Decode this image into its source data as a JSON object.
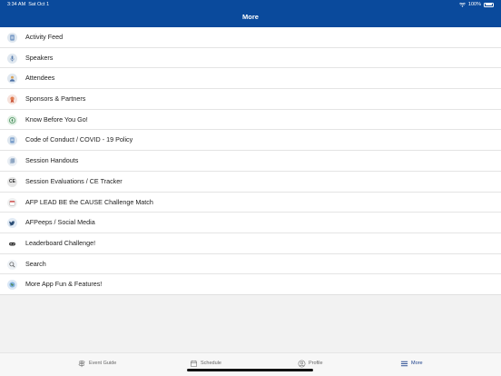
{
  "status": {
    "time": "3:34 AM",
    "date": "Sat Oct 1",
    "battery": "100%"
  },
  "header": {
    "title": "More"
  },
  "menu": [
    {
      "label": "Activity Feed",
      "icon": "activity-feed-icon"
    },
    {
      "label": "Speakers",
      "icon": "microphone-icon"
    },
    {
      "label": "Attendees",
      "icon": "attendees-icon"
    },
    {
      "label": "Sponsors & Partners",
      "icon": "award-ribbon-icon"
    },
    {
      "label": "Know Before You Go!",
      "icon": "compass-icon"
    },
    {
      "label": "Code of Conduct / COVID - 19 Policy",
      "icon": "document-icon"
    },
    {
      "label": "Session Handouts",
      "icon": "handouts-icon"
    },
    {
      "label": "Session Evaluations / CE Tracker",
      "icon": "ce-badge-icon"
    },
    {
      "label": "AFP LEAD BE the CAUSE Challenge Match",
      "icon": "calendar-icon"
    },
    {
      "label": "AFPeeps / Social Media",
      "icon": "twitter-icon"
    },
    {
      "label": "Leaderboard Challenge!",
      "icon": "gamepad-icon"
    },
    {
      "label": "Search",
      "icon": "search-icon"
    },
    {
      "label": "More App Fun  & Features!",
      "icon": "globe-icon"
    }
  ],
  "tabs": [
    {
      "label": "Event Guide",
      "icon": "signpost-icon"
    },
    {
      "label": "Schedule",
      "icon": "calendar-icon"
    },
    {
      "label": "Profile",
      "icon": "profile-icon"
    },
    {
      "label": "More",
      "icon": "menu-lines-icon",
      "active": true
    }
  ],
  "colors": {
    "header": "#0a4a9c",
    "active_tab": "#1b3f8a"
  }
}
